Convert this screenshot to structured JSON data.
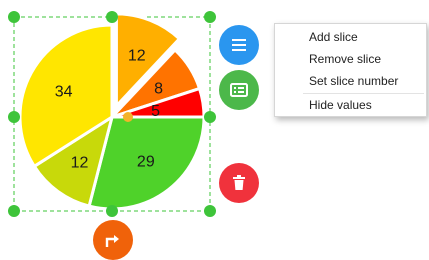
{
  "chart_data": {
    "type": "pie",
    "values": [
      12,
      8,
      5,
      29,
      12,
      34
    ],
    "colors": [
      "#ffaf00",
      "#ff7300",
      "#ff0000",
      "#4fd22a",
      "#c8d90a",
      "#ffe600"
    ],
    "exploded_slice_index": 0,
    "value_labels_visible": true
  },
  "colors": {
    "selection_handle": "#3ec43a",
    "selection_border": "#3ec43a",
    "pivot": "#f3b32a",
    "menu_button": "#2a96ef",
    "table_button": "#4cb84a",
    "delete_button": "#f0323c",
    "connector_button": "#f0620a"
  },
  "toolbar": {
    "menu_icon": "hamburger-icon",
    "table_icon": "data-table-icon",
    "delete_icon": "trash-icon",
    "connector_icon": "connector-arrow-icon"
  },
  "context_menu": {
    "items": [
      "Add slice",
      "Remove slice",
      "Set slice number",
      "Hide values"
    ]
  }
}
